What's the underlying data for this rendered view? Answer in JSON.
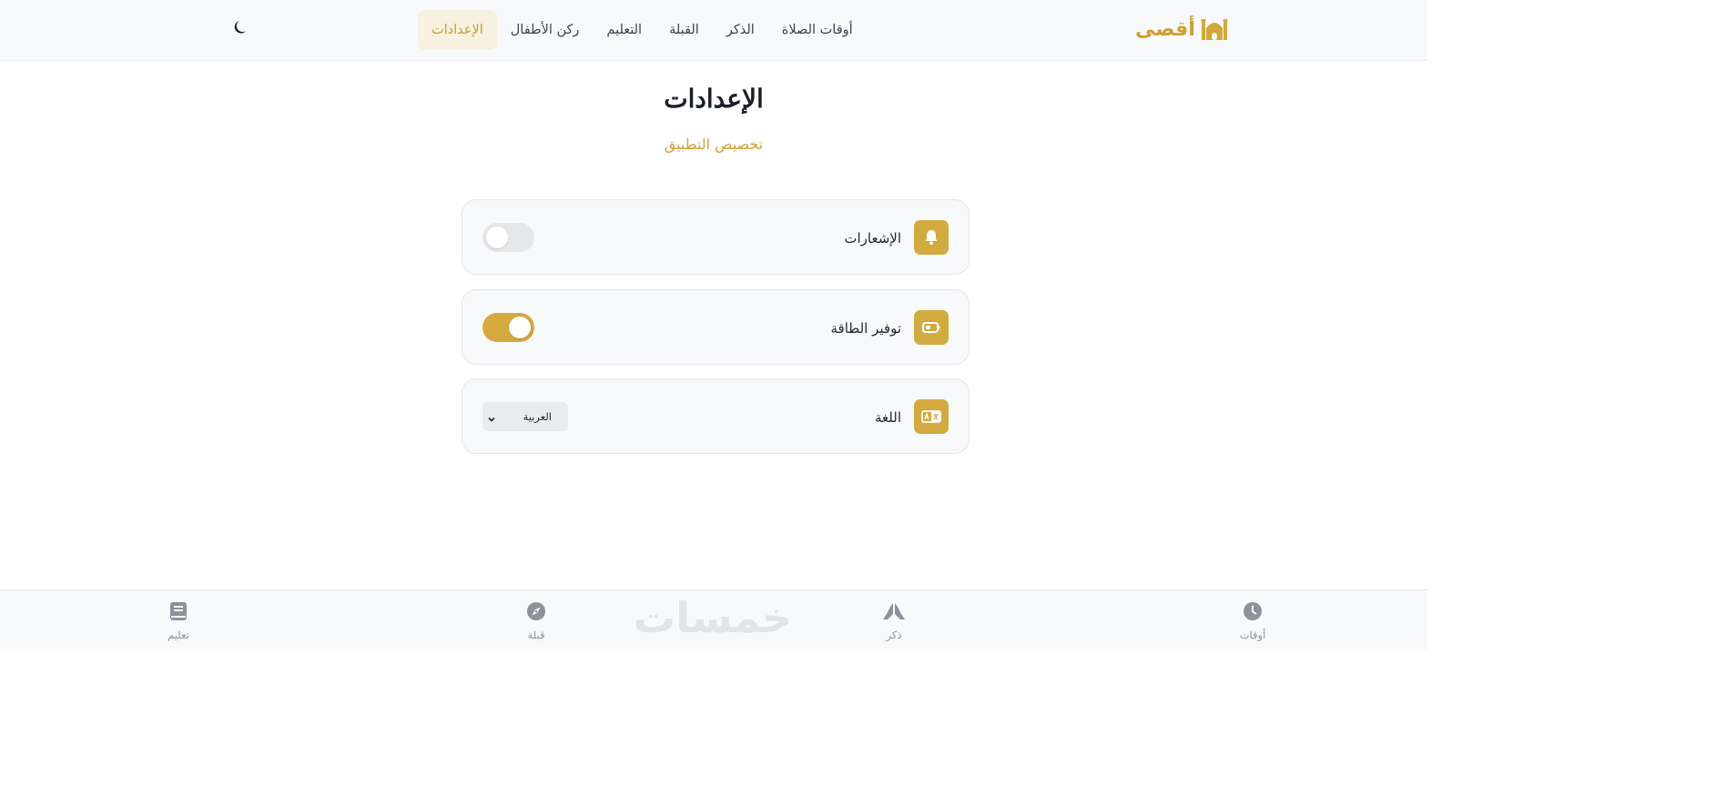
{
  "brand": {
    "name": "أقصى",
    "icon": "mosque-icon",
    "color": "#D2A83A"
  },
  "nav": {
    "links": [
      {
        "label": "أوقات الصلاة",
        "active": false
      },
      {
        "label": "الذكر",
        "active": false
      },
      {
        "label": "القبلة",
        "active": false
      },
      {
        "label": "التعليم",
        "active": false
      },
      {
        "label": "ركن الأطفال",
        "active": false
      },
      {
        "label": "الإعدادات",
        "active": true
      }
    ],
    "theme_icon": "moon-icon"
  },
  "header": {
    "title": "الإعدادات",
    "subtitle": "تخصيص التطبيق"
  },
  "settings": [
    {
      "label": "الإشعارات",
      "icon": "bell-icon",
      "control": "toggle",
      "on": false
    },
    {
      "label": "توفير الطاقة",
      "icon": "battery-icon",
      "control": "toggle",
      "on": true
    },
    {
      "label": "اللغة",
      "icon": "language-icon",
      "control": "select",
      "value": "العربية"
    }
  ],
  "bottom_nav": [
    {
      "label": "أوقات",
      "icon": "clock-icon"
    },
    {
      "label": "ذكر",
      "icon": "praying-hands-icon"
    },
    {
      "label": "قبلة",
      "icon": "compass-icon"
    },
    {
      "label": "تعليم",
      "icon": "book-icon"
    }
  ],
  "watermark": "خمسات",
  "colors": {
    "accent": "#D3AA3D",
    "active_nav_bg": "#F8F1DF",
    "muted": "#8C919B"
  }
}
